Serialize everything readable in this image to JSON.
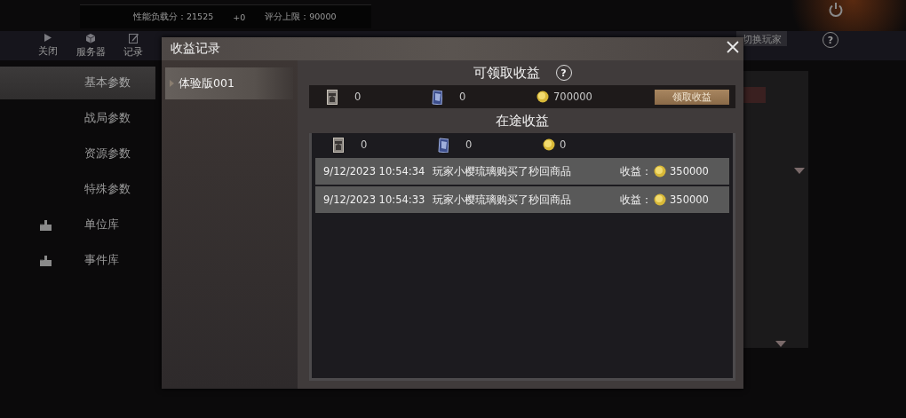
{
  "status_bar": {
    "load_score": "性能负载分：21525",
    "delta": "+0",
    "score_limit": "评分上限：90000"
  },
  "toolbar": [
    {
      "label": "关闭",
      "kind": "play"
    },
    {
      "label": "服务器",
      "kind": "cube"
    },
    {
      "label": "记录",
      "kind": "edit"
    }
  ],
  "switch_player_button": "切换玩家",
  "help": "?",
  "sidebar": {
    "items": [
      {
        "label": "基本参数",
        "selected": true,
        "kind": "plain"
      },
      {
        "label": "战局参数",
        "selected": false,
        "kind": "plain"
      },
      {
        "label": "资源参数",
        "selected": false,
        "kind": "plain"
      },
      {
        "label": "特殊参数",
        "selected": false,
        "kind": "plain"
      },
      {
        "label": "单位库",
        "selected": false,
        "kind": "library"
      },
      {
        "label": "事件库",
        "selected": false,
        "kind": "library"
      }
    ]
  },
  "dialog": {
    "title": "收益记录",
    "versions": [
      {
        "label": "体验版001",
        "selected": true
      }
    ],
    "claimable": {
      "title": "可领取收益",
      "help": "?",
      "resources": [
        {
          "kind": "card",
          "amount": "0"
        },
        {
          "kind": "crystal",
          "amount": "0"
        },
        {
          "kind": "coin",
          "amount": "700000"
        }
      ],
      "claim_button": "领取收益"
    },
    "in_transit": {
      "title": "在途收益",
      "resources": [
        {
          "kind": "card",
          "amount": "0"
        },
        {
          "kind": "crystal",
          "amount": "0"
        },
        {
          "kind": "coin",
          "amount": "0"
        }
      ],
      "records": [
        {
          "time": "9/12/2023 10:54:34",
          "description": "玩家小樱琉璃购买了秒回商品",
          "income_label": "收益：",
          "amount": "350000"
        },
        {
          "time": "9/12/2023 10:54:33",
          "description": "玩家小樱琉璃购买了秒回商品",
          "income_label": "收益：",
          "amount": "350000"
        }
      ]
    }
  }
}
